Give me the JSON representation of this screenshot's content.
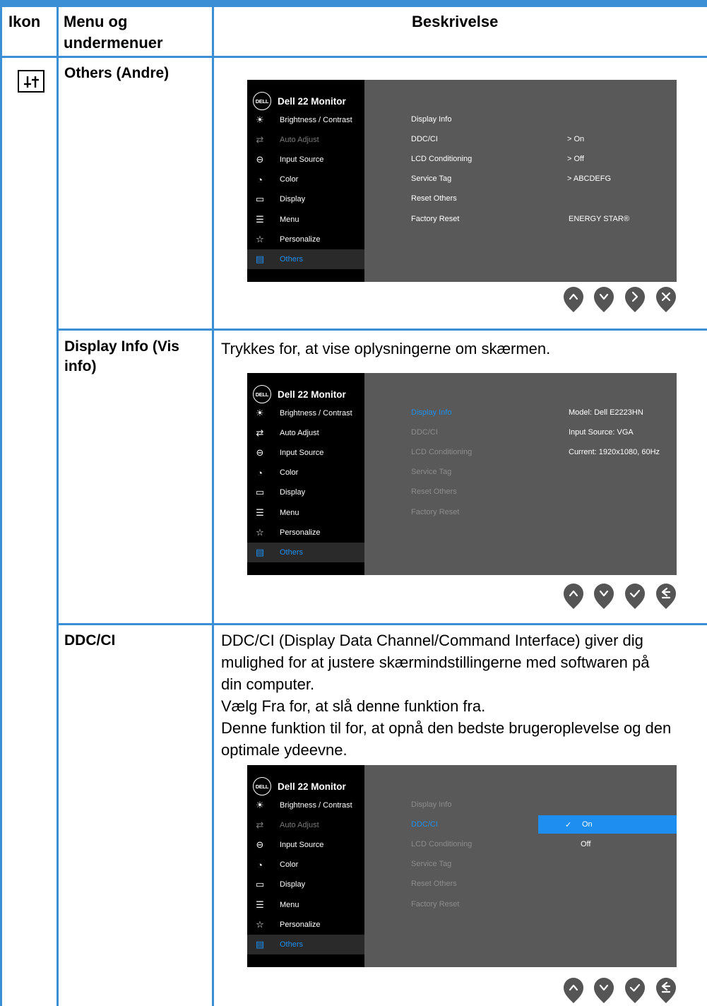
{
  "header": {
    "col_icon": "Ikon",
    "col_menu": "Menu og undermenuer",
    "col_desc": "Beskrivelse"
  },
  "rows": [
    {
      "title": "Others (Andre)",
      "icon": "others-sliders-icon"
    },
    {
      "title": "Display Info (Vis info)",
      "description": "Trykkes for, at vise oplysningerne om skærmen."
    },
    {
      "title": "DDC/CI",
      "description_lines": [
        "DDC/CI (Display Data Channel/Command Interface) giver dig",
        "mulighed for at justere skærmindstillingerne med softwaren på",
        "din computer.",
        "Vælg Fra for, at slå denne funktion fra.",
        "Denne funktion til for, at opnå den bedste brugeroplevelse og den",
        "optimale ydeevne."
      ]
    }
  ],
  "osd": {
    "logo": "DELL",
    "title": "Dell 22 Monitor",
    "menu": [
      "Brightness / Contrast",
      "Auto Adjust",
      "Input Source",
      "Color",
      "Display",
      "Menu",
      "Personalize",
      "Others"
    ],
    "menu_icons": [
      "brightness-icon",
      "auto-adjust-icon",
      "input-source-icon",
      "color-icon",
      "display-icon",
      "menu-icon",
      "personalize-star-icon",
      "others-icon"
    ],
    "submenu": [
      "Display Info",
      "DDC/CI",
      "LCD Conditioning",
      "Service Tag",
      "Reset Others",
      "Factory Reset"
    ],
    "values_others": [
      "> On",
      "> Off",
      "> ABCDEFG"
    ],
    "energy_star": "ENERGY STAR®",
    "info_lines": [
      "Model: Dell E2223HN",
      "Input Source: VGA",
      "Current: 1920x1080, 60Hz"
    ],
    "ddc_options": [
      "On",
      "Off"
    ],
    "check_mark": "✓"
  },
  "colors": {
    "rule": "#3b8fd4",
    "osd_bg": "#595959",
    "osd_sidebar": "#000000",
    "accent": "#1e8ff0"
  }
}
